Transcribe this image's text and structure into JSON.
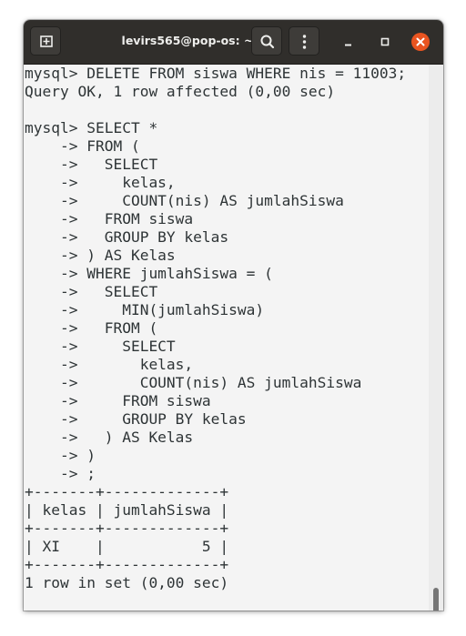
{
  "window": {
    "title": "levirs565@pop-os: ~"
  },
  "icons": {
    "new_tab": "new-tab-icon",
    "search": "search-icon",
    "menu": "kebab-menu-icon",
    "minimize": "minimize-icon",
    "maximize": "maximize-icon",
    "close": "close-icon"
  },
  "colors": {
    "titlebar": "#302e2b",
    "terminal_bg": "#f4f4f4",
    "terminal_fg": "#2e3436",
    "close_button": "#e95420"
  },
  "terminal": {
    "lines": [
      "mysql> DELETE FROM siswa WHERE nis = 11003;",
      "Query OK, 1 row affected (0,00 sec)",
      "",
      "mysql> SELECT *",
      "    -> FROM (",
      "    ->   SELECT",
      "    ->     kelas,",
      "    ->     COUNT(nis) AS jumlahSiswa",
      "    ->   FROM siswa",
      "    ->   GROUP BY kelas",
      "    -> ) AS Kelas",
      "    -> WHERE jumlahSiswa = (",
      "    ->   SELECT",
      "    ->     MIN(jumlahSiswa)",
      "    ->   FROM (",
      "    ->     SELECT",
      "    ->       kelas,",
      "    ->       COUNT(nis) AS jumlahSiswa",
      "    ->     FROM siswa",
      "    ->     GROUP BY kelas",
      "    ->   ) AS Kelas",
      "    -> )",
      "    -> ;",
      "+-------+-------------+",
      "| kelas | jumlahSiswa |",
      "+-------+-------------+",
      "| XI    |           5 |",
      "+-------+-------------+",
      "1 row in set (0,00 sec)"
    ]
  }
}
